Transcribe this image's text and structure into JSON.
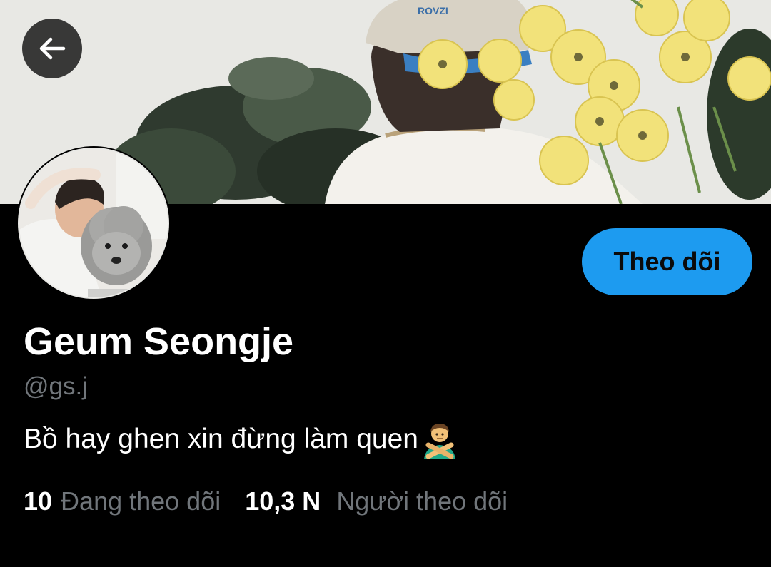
{
  "header": {
    "back_icon": "arrow-left-icon",
    "banner_image": "banner-photo-flowers"
  },
  "profile": {
    "avatar_image": "avatar-photo-man-with-dog",
    "follow_label": "Theo dõi",
    "display_name": "Geum Seongje",
    "handle": "@gs.j",
    "bio_text": "Bồ hay ghen xin đừng làm quen",
    "bio_emoji": "man-gesturing-no-emoji",
    "following_count": "10",
    "following_label": "Đang theo dõi",
    "followers_count": "10,3 N",
    "followers_label": "Người theo dõi"
  },
  "colors": {
    "accent": "#1d9bf0",
    "background": "#000000",
    "secondary_text": "#71767b"
  }
}
